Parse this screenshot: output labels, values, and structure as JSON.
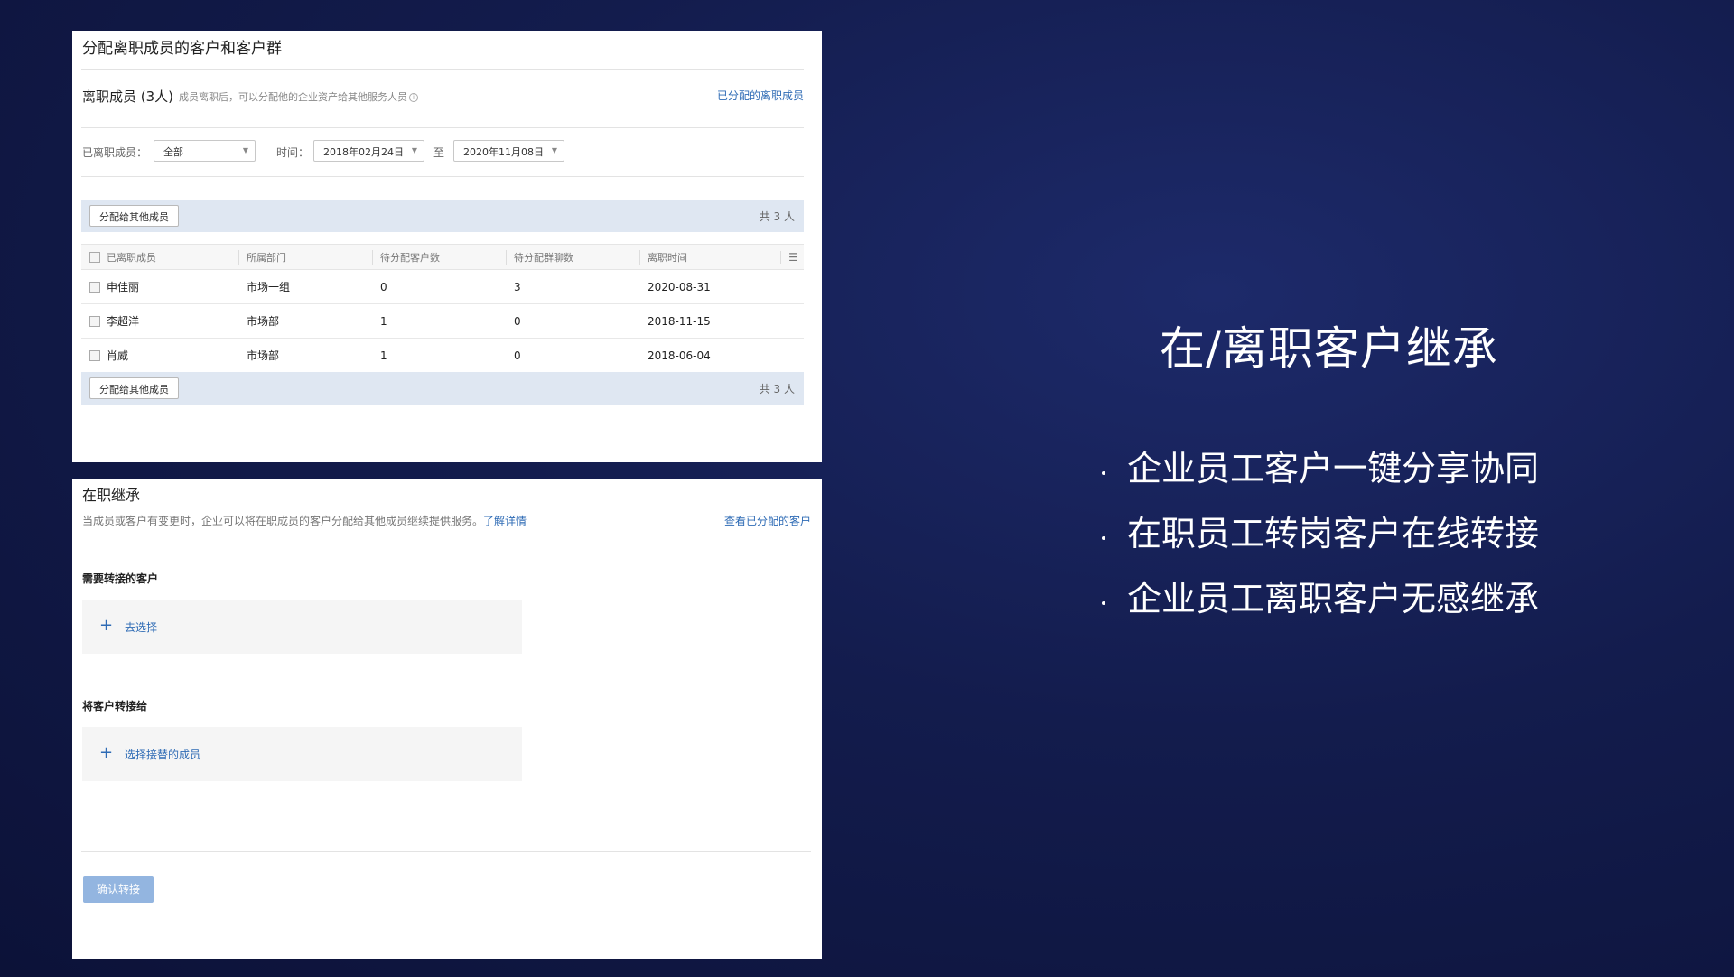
{
  "top_panel": {
    "title": "分配离职成员的客户和客户群",
    "section_title": "离职成员 (3人)",
    "section_note": "成员离职后，可以分配他的企业资产给其他服务人员",
    "assigned_link": "已分配的离职成员",
    "filter_member_label": "已离职成员：",
    "filter_member_value": "全部",
    "time_label": "时间：",
    "date_from": "2018年02月24日",
    "date_to_label": "至",
    "date_to": "2020年11月08日",
    "assign_button": "分配给其他成员",
    "total": "共 3 人",
    "columns": [
      "已离职成员",
      "所属部门",
      "待分配客户数",
      "待分配群聊数",
      "离职时间"
    ],
    "rows": [
      [
        "申佳丽",
        "市场一组",
        "0",
        "3",
        "2020-08-31"
      ],
      [
        "李超洋",
        "市场部",
        "1",
        "0",
        "2018-11-15"
      ],
      [
        "肖威",
        "市场部",
        "1",
        "0",
        "2018-06-04"
      ]
    ]
  },
  "bottom_panel": {
    "title": "在职继承",
    "description": "当成员或客户有变更时，企业可以将在职成员的客户分配给其他成员继续提供服务。",
    "learn_more": "了解详情",
    "view_assigned": "查看已分配的客户",
    "need_transfer_label": "需要转接的客户",
    "select_customers": "去选择",
    "transfer_to_label": "将客户转接给",
    "select_member": "选择接替的成员",
    "confirm_button": "确认转接"
  },
  "right": {
    "title": "在/离职客户继承",
    "bullets": [
      "企业员工客户一键分享协同",
      "在职员工转岗客户在线转接",
      "企业员工离职客户无感继承"
    ]
  }
}
